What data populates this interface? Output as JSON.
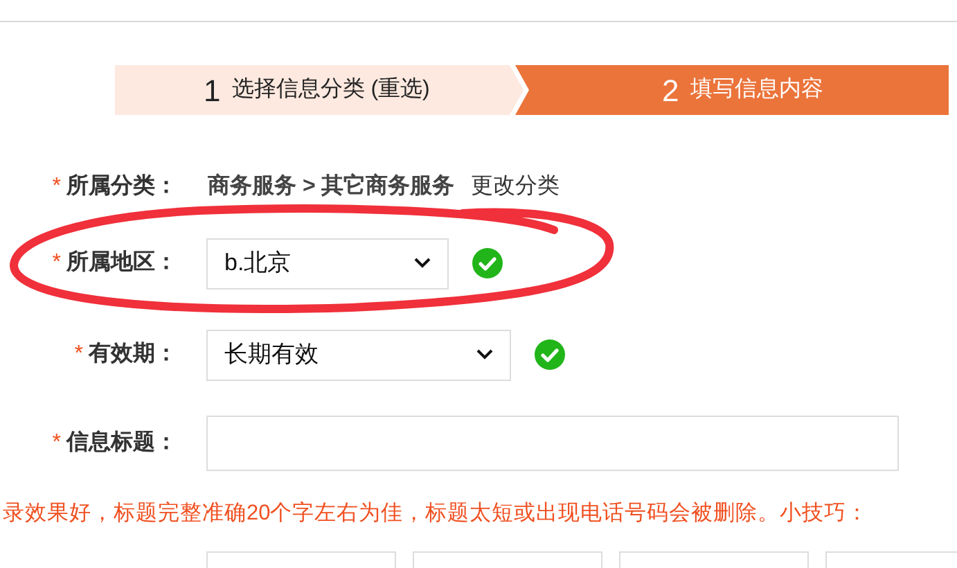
{
  "steps": [
    {
      "number": "1",
      "label": "选择信息分类",
      "action": "(重选)",
      "selected": false
    },
    {
      "number": "2",
      "label": "填写信息内容",
      "selected": true
    }
  ],
  "form": [
    {
      "kind": "static",
      "label": "所属分类：",
      "required": "*",
      "value": "商务服务 > 其它商务服务",
      "link": "更改分类"
    },
    {
      "kind": "select",
      "label": "所属地区：",
      "required": "*",
      "value": "b.北京",
      "valid": true
    },
    {
      "kind": "select",
      "label": "有效期：",
      "required": "*",
      "value": "长期有效",
      "valid": true
    },
    {
      "kind": "input",
      "label": "信息标题：",
      "required": "*"
    }
  ],
  "hint": "录效果好，标题完整准确20个字左右为佳，标题太短或出现电话号码会被删除。小技巧："
}
